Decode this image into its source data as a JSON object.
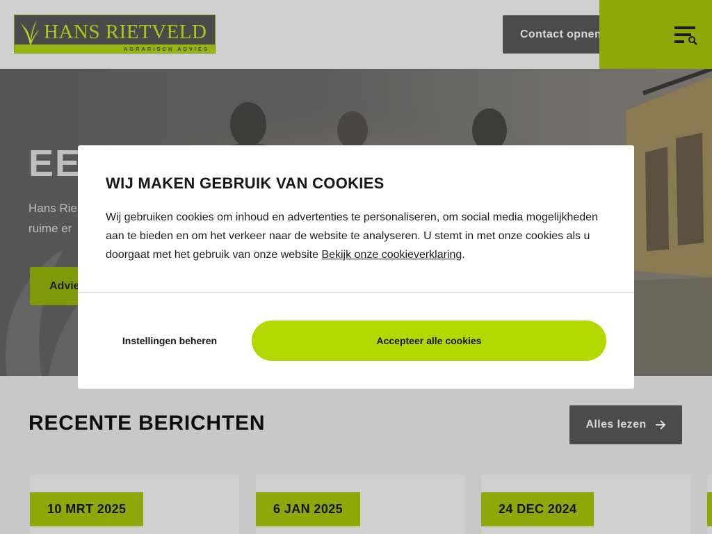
{
  "header": {
    "logo_text": "HANS RIETVELD",
    "logo_subtext": "AGRARISCH ADVIES",
    "contact_label": "Contact opnemen"
  },
  "hero": {
    "title_visible": "EE",
    "subtitle_line1": "Hans Rie",
    "subtitle_line2": "ruime er",
    "button_label": "Advie"
  },
  "cookie_modal": {
    "title": "WIJ MAKEN GEBRUIK VAN COOKIES",
    "body": "Wij gebruiken cookies om inhoud en advertenties te personaliseren, om social media mogelijkheden aan te bieden en om het verkeer naar de website te analyseren. U stemt in met onze cookies als u doorgaat met het gebruik van onze website ",
    "link_text": "Bekijk onze cookieverklaring",
    "body_end": ".",
    "settings_label": "Instellingen beheren",
    "accept_label": "Accepteer alle cookies"
  },
  "recent": {
    "title": "RECENTE BERICHTEN",
    "read_all_label": "Alles lezen",
    "posts": [
      {
        "date": "10 MRT 2025"
      },
      {
        "date": "6 JAN 2025"
      },
      {
        "date": "24 DEC 2024"
      }
    ]
  },
  "colors": {
    "brand_green": "#8ea80a",
    "accept_green": "#b3d800",
    "dark_button": "#4b4b4b"
  },
  "icons": [
    "arrow-right-icon",
    "menu-search-icon",
    "grass-logo-icon"
  ]
}
